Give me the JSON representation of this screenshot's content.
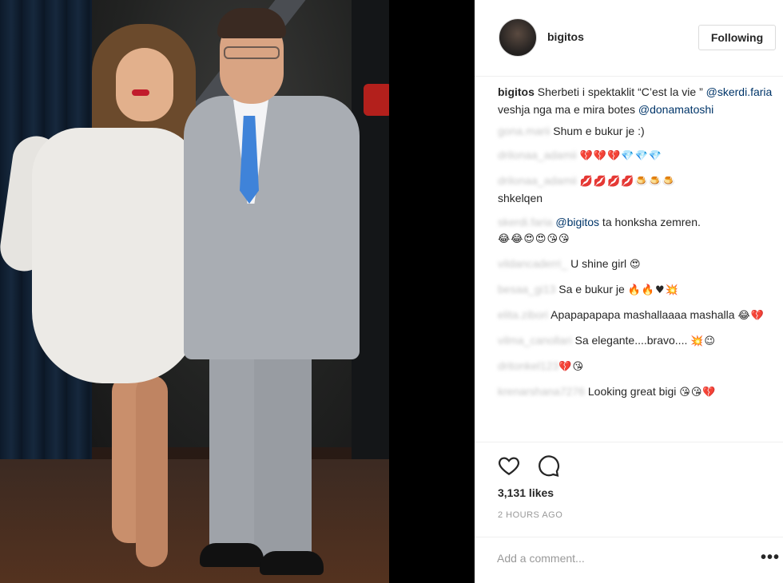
{
  "header": {
    "username": "bigitos",
    "follow_label": "Following"
  },
  "caption": {
    "username": "bigitos",
    "text_1": "Sherbeti i spektaklit “C’est la vie ”",
    "mention_1": "@skerdi.faria",
    "text_2": " veshja nga ma e mira botes ",
    "mention_2": "@donamatoshi"
  },
  "comments": [
    {
      "user": "gona.marii",
      "text": "Shum e bukur je :)",
      "emoji": ""
    },
    {
      "user": "drilonaa_adamii",
      "text": "",
      "emoji": "💔💔💔💎💎💎"
    },
    {
      "user": "drilonaa_adamii",
      "text": "shkelqen",
      "emoji": "💋💋💋💋🍮🍮🍮"
    },
    {
      "user": "skerdi.faria",
      "mention": "@bigitos",
      "text": " ta honksha zemren.",
      "emoji": "😂😂😍😍😘😘"
    },
    {
      "user": "vildancaderri_",
      "text": "U shine girl ",
      "emoji": "😍"
    },
    {
      "user": "besaa_gi13",
      "text": "Sa e bukur je ",
      "emoji": "🔥🔥♥💥"
    },
    {
      "user": "elita.zibori",
      "text": "Apapapapapa mashallaaaa mashalla ",
      "emoji": "😂💔"
    },
    {
      "user": "vilma_canollari",
      "text": "Sa elegante....bravo.... ",
      "emoji": "💥😉"
    },
    {
      "user": "dritonkel123",
      "text": "",
      "emoji": "💔😘"
    },
    {
      "user": "krenarshana7276",
      "text": "Looking great bigi ",
      "emoji": "😘😘💔"
    }
  ],
  "actions": {
    "likes": "3,131 likes",
    "time": "2 HOURS AGO"
  },
  "add_comment": {
    "placeholder": "Add a comment...",
    "more": "•••"
  }
}
